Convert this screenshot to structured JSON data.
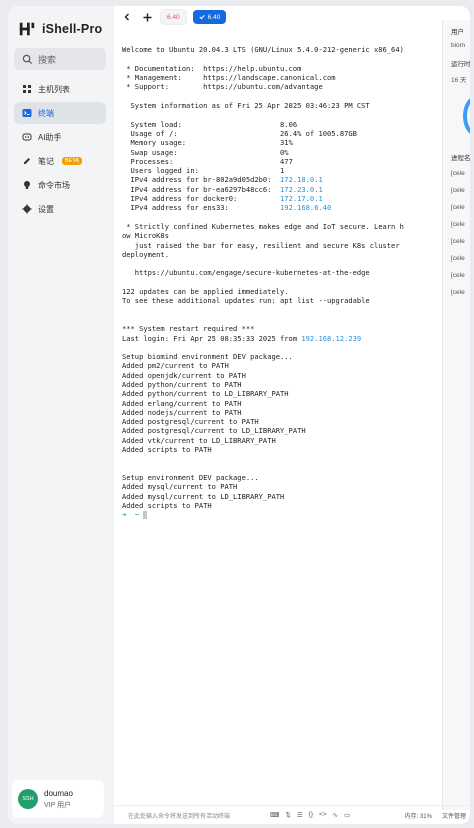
{
  "app": {
    "title": "iShell-Pro"
  },
  "search": {
    "placeholder": "搜索"
  },
  "nav": [
    {
      "label": "主机列表",
      "icon": "host-list-icon"
    },
    {
      "label": "终端",
      "icon": "terminal-icon",
      "active": true
    },
    {
      "label": "AI助手",
      "icon": "ai-icon"
    },
    {
      "label": "笔记",
      "icon": "note-icon",
      "badge": "BETA"
    },
    {
      "label": "命令市场",
      "icon": "bulb-icon"
    },
    {
      "label": "设置",
      "icon": "gear-icon"
    }
  ],
  "user": {
    "avatar": "SSH",
    "name": "doumao",
    "role": "VIP 用户"
  },
  "tabs": [
    {
      "label": "6.40",
      "color": "#e05555"
    },
    {
      "label": "6.40",
      "active": true,
      "color": "#1769e0"
    }
  ],
  "terminal": {
    "welcome": "Welcome to Ubuntu 20.04.3 LTS (GNU/Linux 5.4.0-212-generic x86_64)",
    "links": [
      " * Documentation:  https://help.ubuntu.com",
      " * Management:     https://landscape.canonical.com",
      " * Support:        https://ubuntu.com/advantage"
    ],
    "sysinfo_header": "  System information as of Fri 25 Apr 2025 03:46:23 PM CST",
    "stats": [
      {
        "k": "  System load:",
        "v": "8.06"
      },
      {
        "k": "  Usage of /:",
        "v": "26.4% of 1005.87GB"
      },
      {
        "k": "  Memory usage:",
        "v": "31%"
      },
      {
        "k": "  Swap usage:",
        "v": "0%"
      },
      {
        "k": "  Processes:",
        "v": "477"
      },
      {
        "k": "  Users logged in:",
        "v": "1"
      },
      {
        "k": "  IPv4 address for br-802a9d05d2b0:",
        "v": "172.18.0.1",
        "ip": true
      },
      {
        "k": "  IPv4 address for br-ea6297b48cc6:",
        "v": "172.23.0.1",
        "ip": true
      },
      {
        "k": "  IPv4 address for docker0:",
        "v": "172.17.0.1",
        "ip": true
      },
      {
        "k": "  IPv4 address for ens33:",
        "v": "192.168.6.40",
        "ip": true
      }
    ],
    "microk8s": [
      " * Strictly confined Kubernetes makes edge and IoT secure. Learn h",
      "ow MicroK8s",
      "   just raised the bar for easy, resilient and secure K8s cluster",
      "deployment."
    ],
    "k8s_url": "   https://ubuntu.com/engage/secure-kubernetes-at-the-edge",
    "updates": [
      "122 updates can be applied immediately.",
      "To see these additional updates run: apt list --upgradable"
    ],
    "restart": "*** System restart required ***",
    "last_login": "Last login: Fri Apr 25 08:35:33 2025 from ",
    "last_login_ip": "192.168.12.239",
    "setup1": [
      "Setup biomind environment DEV package...",
      "Added pm2/current to PATH",
      "Added openjdk/current to PATH",
      "Added python/current to PATH",
      "Added python/current to LD_LIBRARY_PATH",
      "Added erlang/current to PATH",
      "Added nodejs/current to PATH",
      "Added postgresql/current to PATH",
      "Added postgresql/current to LD_LIBRARY_PATH",
      "Added vtk/current to LD_LIBRARY_PATH",
      "Added scripts to PATH"
    ],
    "setup2": [
      "Setup environment DEV package...",
      "Added mysql/current to PATH",
      "Added mysql/current to LD_LIBRARY_PATH",
      "Added scripts to PATH"
    ],
    "prompt": "➜  ~"
  },
  "statusbar": {
    "input_placeholder": "在此处输入命令将发送到所有活动终端",
    "icons": [
      "⌨",
      "⇅",
      "☰",
      "{}",
      "<>",
      "∿",
      "▭"
    ],
    "memory": "内存: 31%",
    "file_manager": "文件管理"
  },
  "rightpanel": {
    "user_label": "用户",
    "user_value": "biom",
    "run_label": "运行时",
    "run_value": "16 天",
    "proc_label": "进程名",
    "proc_rows": [
      "[cele",
      "[cele",
      "[cele",
      "[cele",
      "[cele",
      "[cele",
      "[cele",
      "[cele"
    ]
  }
}
